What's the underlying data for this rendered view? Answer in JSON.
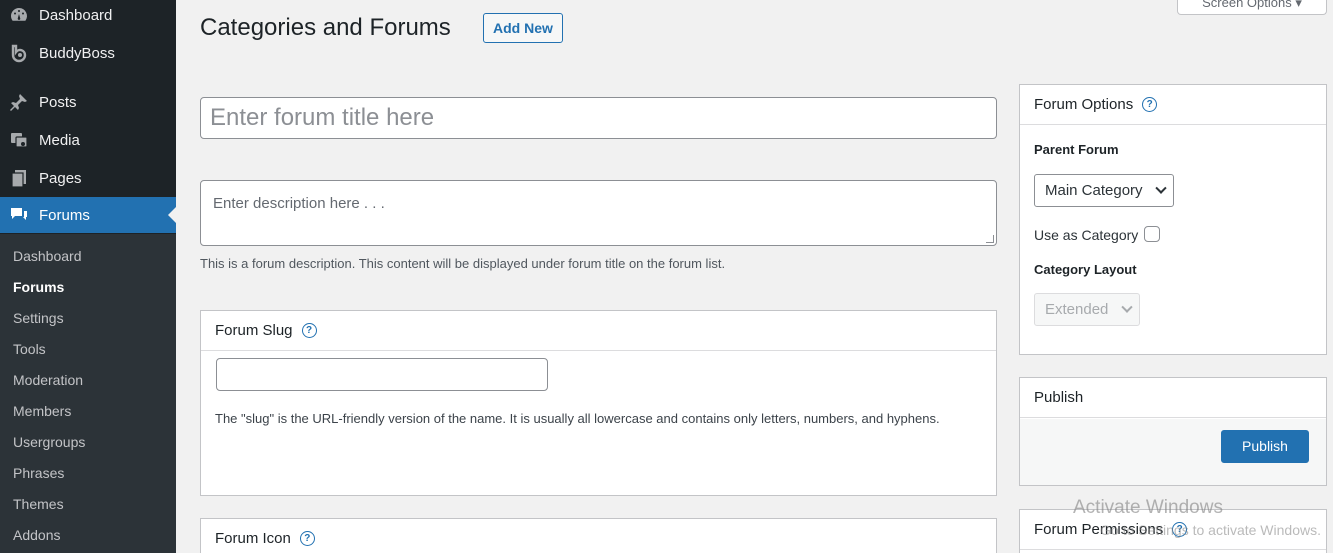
{
  "sidebar": {
    "items": [
      {
        "label": "Dashboard",
        "icon": "dashboard-icon"
      },
      {
        "label": "BuddyBoss",
        "icon": "buddyboss-icon"
      },
      {
        "label": "Posts",
        "icon": "pushpin-icon"
      },
      {
        "label": "Media",
        "icon": "media-icon"
      },
      {
        "label": "Pages",
        "icon": "pages-icon"
      },
      {
        "label": "Forums",
        "icon": "forums-icon",
        "active": true
      }
    ],
    "submenu": [
      "Dashboard",
      "Forums",
      "Settings",
      "Tools",
      "Moderation",
      "Members",
      "Usergroups",
      "Phrases",
      "Themes",
      "Addons"
    ]
  },
  "header": {
    "title": "Categories and Forums",
    "add_new": "Add New",
    "screen_options": "Screen Options"
  },
  "editor": {
    "title_placeholder": "Enter forum title here",
    "description_placeholder": "Enter description here . . .",
    "description_help": "This is a forum description. This content will be displayed under forum title on the forum list."
  },
  "slug_box": {
    "title": "Forum Slug",
    "value": "",
    "help": "The \"slug\" is the URL-friendly version of the name. It is usually all lowercase and contains only letters, numbers, and hyphens."
  },
  "icon_box": {
    "title": "Forum Icon"
  },
  "forum_options": {
    "title": "Forum Options",
    "parent_label": "Parent Forum",
    "parent_value": "Main Category",
    "use_as_category_label": "Use as Category",
    "use_as_category_checked": false,
    "layout_label": "Category Layout",
    "layout_value": "Extended"
  },
  "publish_box": {
    "title": "Publish",
    "button": "Publish"
  },
  "permissions_box": {
    "title": "Forum Permissions"
  },
  "watermark": {
    "title": "Activate Windows",
    "subtitle": "Go to Settings to activate Windows."
  },
  "colors": {
    "sidebar_bg": "#1d2327",
    "submenu_bg": "#2c3338",
    "accent": "#2271b1",
    "page_bg": "#f1f1f1"
  }
}
